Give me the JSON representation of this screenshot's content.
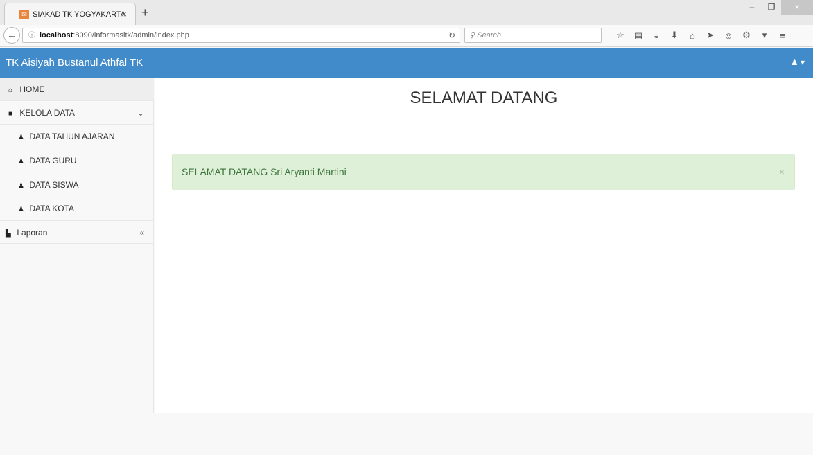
{
  "browser": {
    "tab_title": "SIAKAD TK YOGYAKARTA",
    "tab_close": "×",
    "new_tab": "+",
    "url_host": "localhost",
    "url_rest": ":8090/informasitk/admin/index.php",
    "search_placeholder": "Search",
    "window_buttons": [
      "–",
      "❐",
      "×"
    ]
  },
  "app": {
    "brand": "TK Aisiyah Bustanul Athfal TK",
    "user_menu": "▾"
  },
  "sidebar": {
    "home": "HOME",
    "kelola_data": "KELOLA DATA",
    "sub_items": [
      "DATA TAHUN AJARAN",
      "DATA GURU",
      "DATA SISWA",
      "DATA KOTA"
    ],
    "laporan": "Laporan"
  },
  "main": {
    "title": "SELAMAT DATANG",
    "alert_text": "SELAMAT DATANG Sri Aryanti Martini",
    "alert_close": "×"
  },
  "colors": {
    "header": "#428bca",
    "alert_bg": "#dff0d8",
    "alert_text": "#3c763d"
  }
}
